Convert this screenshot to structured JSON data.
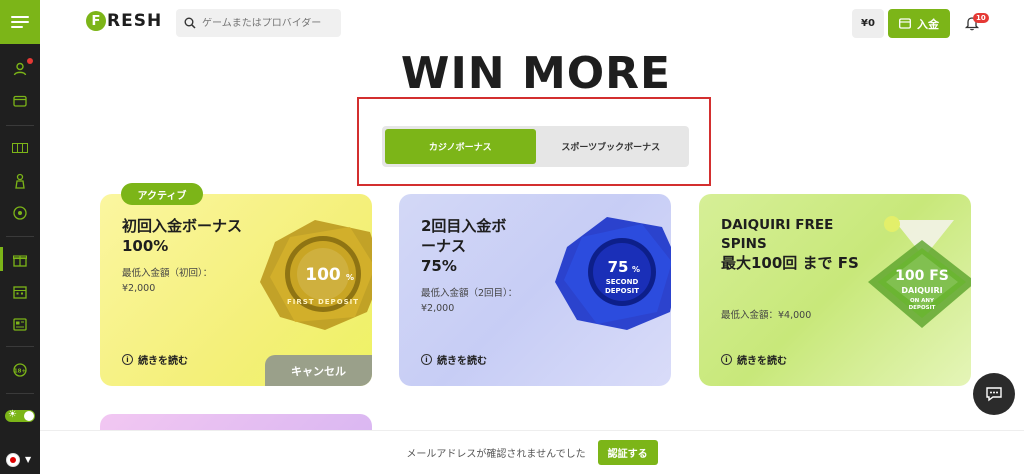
{
  "header": {
    "logo_letter": "F",
    "logo_rest": "RESH",
    "search_placeholder": "ゲームまたはプロバイダー",
    "balance": "¥0",
    "deposit_label": "入金",
    "notification_count": "10"
  },
  "main": {
    "title": "WIN MORE",
    "tabs": [
      {
        "label": "カジノボーナス",
        "active": true
      },
      {
        "label": "スポーツブックボーナス",
        "active": false
      }
    ],
    "active_badge": "アクティブ"
  },
  "cards": [
    {
      "title": "初回入金ボーナス",
      "percent": "100%",
      "min_deposit_line1": "最低入金額（初回）：",
      "min_deposit_line2": "¥2,000",
      "read_more": "続きを読む",
      "cancel_label": "キャンセル",
      "badge_main": "100",
      "badge_pct": "%",
      "badge_sub": "FIRST DEPOSIT"
    },
    {
      "title": "2回目入金ボーナス",
      "percent": "75%",
      "min_deposit_line1": "最低入金額（2回目）：",
      "min_deposit_line2": "¥2,000",
      "read_more": "続きを読む",
      "badge_main": "75",
      "badge_pct": "%",
      "badge_sub1": "SECOND",
      "badge_sub2": "DEPOSIT"
    },
    {
      "title": "DAIQUIRI FREE SPINS",
      "subtitle": "最大100回 まで FS",
      "min_deposit_line1": "最低入金額：¥4,000",
      "read_more": "続きを読む",
      "badge_main": "100 FS",
      "badge_sub1": "DAIQUIRI",
      "badge_sub2": "ON ANY",
      "badge_sub3": "DEPOSIT"
    }
  ],
  "bottom_bar": {
    "message": "メールアドレスが確認されませんでした",
    "verify_label": "認証する"
  },
  "colors": {
    "brand_green": "#7cb518",
    "sidebar_bg": "#1f1f1f",
    "highlight_red": "#d32f2f"
  }
}
